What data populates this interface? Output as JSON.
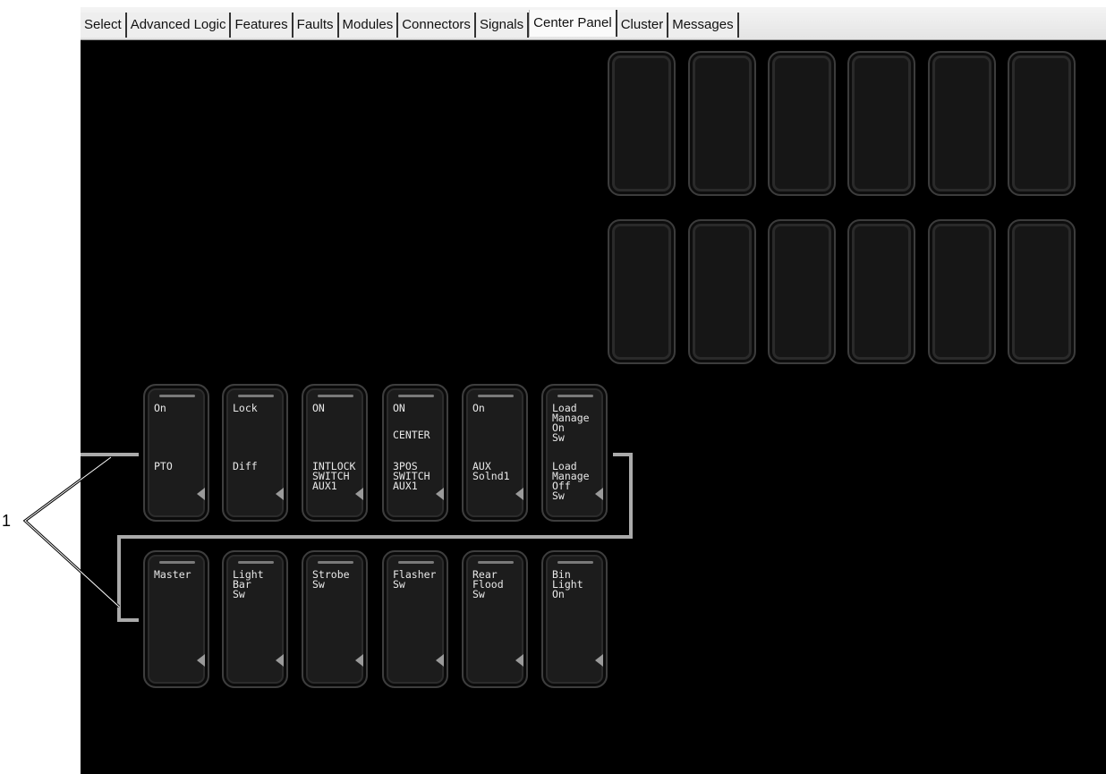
{
  "tabs": [
    "Select",
    "Advanced Logic",
    "Features",
    "Faults",
    "Modules",
    "Connectors",
    "Signals",
    "Center Panel",
    "Cluster",
    "Messages"
  ],
  "active_tab": "Center Panel",
  "callout_label": "1",
  "row1": [
    {
      "top": "On",
      "bottom": "PTO"
    },
    {
      "top": "Lock",
      "bottom": "Diff"
    },
    {
      "top": "ON",
      "bottom": "INTLOCK\nSWITCH\nAUX1"
    },
    {
      "top": "ON",
      "middle": "CENTER",
      "bottom": "3POS\nSWITCH\nAUX1"
    },
    {
      "top": "On",
      "bottom": "AUX\nSolnd1"
    },
    {
      "top": "Load\nManage\nOn\nSw",
      "bottom": "Load\nManage\nOff\nSw"
    }
  ],
  "row2": [
    {
      "top": "Master"
    },
    {
      "top": "Light\nBar\nSw"
    },
    {
      "top": "Strobe\nSw"
    },
    {
      "top": "Flasher\nSw"
    },
    {
      "top": "Rear\nFlood\nSw"
    },
    {
      "top": "Bin\nLight\nOn"
    }
  ]
}
